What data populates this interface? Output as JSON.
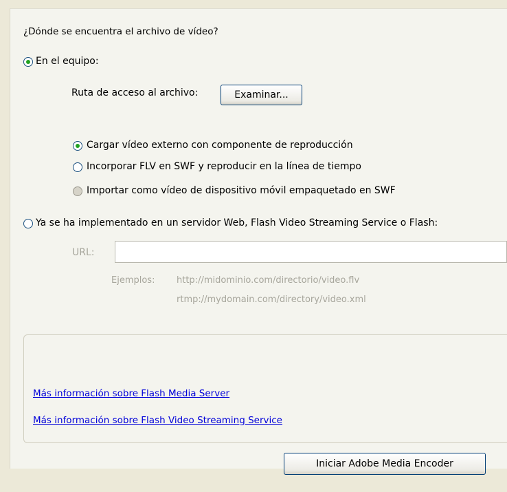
{
  "question": "¿Dónde se encuentra el archivo de vídeo?",
  "source_options": {
    "local": {
      "label": "En el equipo:",
      "checked": true
    },
    "server": {
      "label": "Ya se ha implementado en un servidor Web, Flash Video Streaming Service o Flash:",
      "checked": false
    }
  },
  "file_path": {
    "label": "Ruta de acceso al archivo:",
    "browse_button": "Examinar..."
  },
  "deployment_options": [
    {
      "label": "Cargar vídeo externo con componente de reproducción",
      "checked": true,
      "enabled": true
    },
    {
      "label": "Incorporar FLV en SWF y reproducir en la línea de tiempo",
      "checked": false,
      "enabled": true
    },
    {
      "label": "Importar como vídeo de dispositivo móvil empaquetado en SWF",
      "checked": false,
      "enabled": false
    }
  ],
  "url": {
    "label": "URL:",
    "value": ""
  },
  "examples": {
    "label": "Ejemplos:",
    "items": [
      "http://midominio.com/directorio/video.flv",
      "rtmp://mydomain.com/directory/video.xml"
    ]
  },
  "links": {
    "media_server": "Más información sobre Flash Media Server",
    "streaming_service": "Más información sobre Flash Video Streaming Service"
  },
  "encoder_button": "Iniciar Adobe Media Encoder",
  "colors": {
    "panel": "#f4f4ee",
    "window": "#ece9d8",
    "link": "#0000d9",
    "radio_dot": "#21a121"
  }
}
